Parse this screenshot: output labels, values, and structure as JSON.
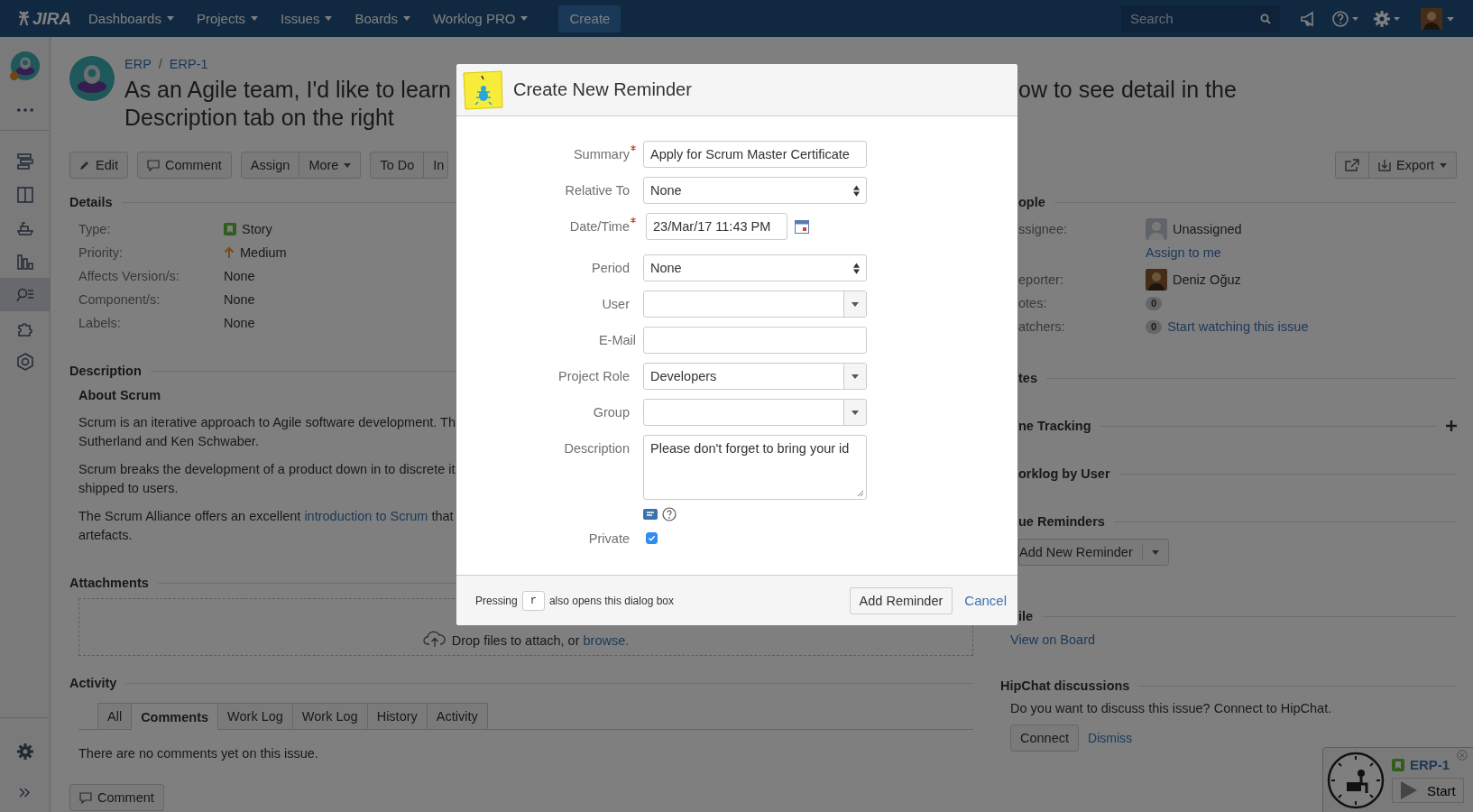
{
  "top_nav": {
    "logo": "JIRA",
    "menus": [
      {
        "label": "Dashboards"
      },
      {
        "label": "Projects"
      },
      {
        "label": "Issues"
      },
      {
        "label": "Boards"
      },
      {
        "label": "Worklog PRO"
      }
    ],
    "create": "Create",
    "search": {
      "placeholder": "Search"
    }
  },
  "sidebar": {
    "items": [
      {
        "selected": false
      },
      {
        "selected": false
      },
      {
        "selected": false
      },
      {
        "selected": false
      },
      {
        "selected": true
      },
      {
        "selected": false
      },
      {
        "selected": false
      }
    ]
  },
  "issue": {
    "breadcrumbs": [
      "ERP",
      "ERP-1"
    ],
    "breadcrumb_separator": "/",
    "title_start": "As an Agile team, I'd like to learn",
    "title_end": "ow to see detail in the",
    "title_line2": "Description tab on the right"
  },
  "toolbar": {
    "edit": "Edit",
    "comment": "Comment",
    "assign": "Assign",
    "more": "More",
    "todo": "To Do",
    "in_progress": "In",
    "export": "Export"
  },
  "details": {
    "heading": "Details",
    "rows": [
      {
        "label": "Type:",
        "value": "Story",
        "kind": "type"
      },
      {
        "label": "Priority:",
        "value": "Medium",
        "kind": "priority"
      },
      {
        "label": "Affects Version/s:",
        "value": "None",
        "kind": "plain"
      },
      {
        "label": "Component/s:",
        "value": "None",
        "kind": "plain"
      },
      {
        "label": "Labels:",
        "value": "None",
        "kind": "plain"
      }
    ]
  },
  "description": {
    "heading": "Description",
    "subheading": "About Scrum",
    "paragraphs": [
      {
        "lines": [
          "Scrum is an iterative approach to Agile software development. Th",
          "Sutherland and Ken Schwaber."
        ]
      },
      {
        "lines": [
          "Scrum breaks the development of a product down in to discrete it",
          "shipped to users."
        ]
      },
      {
        "lines": [
          "The Scrum Alliance offers an excellent ",
          "artefacts."
        ],
        "link": "introduction to Scrum",
        "after": " that"
      }
    ]
  },
  "attachments": {
    "heading": "Attachments",
    "drop_text": "Drop files to attach, or ",
    "browse": "browse."
  },
  "activity": {
    "heading": "Activity",
    "tabs": [
      {
        "label": "All",
        "selected": false
      },
      {
        "label": "Comments",
        "selected": true
      },
      {
        "label": "Work Log",
        "selected": false
      },
      {
        "label": "Work Log",
        "selected": false
      },
      {
        "label": "History",
        "selected": false
      },
      {
        "label": "Activity",
        "selected": false
      }
    ],
    "empty": "There are no comments yet on this issue.",
    "comment_button": "Comment"
  },
  "people": {
    "heading": "ople",
    "assignee": {
      "label": "ssignee:",
      "value": "Unassigned",
      "action": "Assign to me"
    },
    "reporter": {
      "label": "eporter:",
      "value": "Deniz Oğuz"
    },
    "votes": {
      "label": "otes:",
      "count": "0"
    },
    "watchers": {
      "label": "atchers:",
      "count": "0",
      "action": "Start watching this issue"
    }
  },
  "sections": {
    "dates": "tes",
    "time_tracking": "ne Tracking",
    "worklog": "orklog by User",
    "reminders": {
      "heading": "ue Reminders",
      "button": "Add New Reminder"
    },
    "agile": {
      "heading": "ile",
      "link": "View on Board"
    },
    "hipchat": {
      "heading": "HipChat discussions",
      "text": "Do you want to discuss this issue? Connect to HipChat.",
      "connect": "Connect",
      "dismiss": "Dismiss"
    }
  },
  "timer": {
    "issue": "ERP-1",
    "start": "Start"
  },
  "dialog": {
    "title": "Create New Reminder",
    "fields": [
      {
        "label": "Summary",
        "kind": "text",
        "required": true,
        "value": "Apply for Scrum Master Certificate"
      },
      {
        "label": "Relative To",
        "kind": "select",
        "required": false,
        "value": "None"
      },
      {
        "label": "Date/Time",
        "kind": "datetime",
        "required": true,
        "value": "23/Mar/17 11:43 PM"
      },
      {
        "label": "Period",
        "kind": "select",
        "required": false,
        "value": "None"
      },
      {
        "label": "User",
        "kind": "combo",
        "required": false
      },
      {
        "label": "E-Mail",
        "kind": "text",
        "required": false
      },
      {
        "label": "Project Role",
        "kind": "combo",
        "required": false,
        "value": "Developers"
      },
      {
        "label": "Group",
        "kind": "combo",
        "required": false
      },
      {
        "label": "Description",
        "kind": "textarea",
        "required": false,
        "value": "Please don't forget to bring your id"
      },
      {
        "label": "Private",
        "kind": "checkbox",
        "required": false,
        "checked": true
      }
    ],
    "footer": {
      "hint_before": "Pressing",
      "key": "r",
      "hint_after": "also opens this dialog box",
      "submit": "Add Reminder",
      "cancel": "Cancel"
    }
  }
}
